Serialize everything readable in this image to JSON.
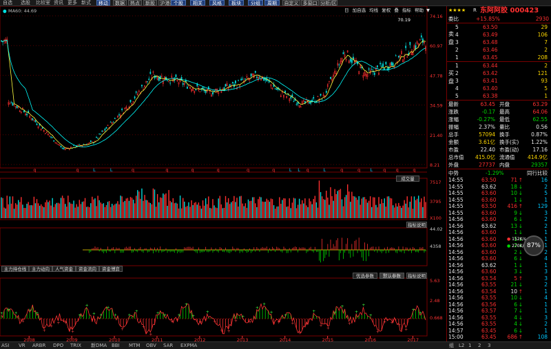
{
  "menu": [
    "自选",
    "选股",
    "比较室",
    "资讯",
    "更多",
    "新式"
  ],
  "toolbar": [
    "移动",
    "数据",
    "热点",
    "新股",
    "沪港通",
    "个股",
    "相关",
    "风格",
    "板块",
    "分组",
    "周期",
    "自定义",
    "多窗口",
    "分析/区"
  ],
  "chart_header": {
    "period_menu": [
      "日",
      "加自选",
      "均线",
      "复权",
      "叠",
      "指标",
      "帮助",
      "▼"
    ],
    "ma_label": "MA60: 44.69"
  },
  "stock": {
    "stars": "★★★★",
    "code_marker": "R",
    "name": "东阿阿胶 000423"
  },
  "order_book": {
    "weibi_label": "委比",
    "weibi_value": "+15.85%",
    "weicha_value": "2930",
    "sell_label": "卖盘",
    "buy_label": "买盘",
    "asks": [
      {
        "level": "5",
        "price": "63.50",
        "vol": "29"
      },
      {
        "level": "4",
        "price": "63.49",
        "vol": "106"
      },
      {
        "level": "3",
        "price": "63.48",
        "vol": "7"
      },
      {
        "level": "2",
        "price": "63.46",
        "vol": "2"
      },
      {
        "level": "1",
        "price": "63.45",
        "vol": "208"
      }
    ],
    "bids": [
      {
        "level": "1",
        "price": "63.44",
        "vol": "2"
      },
      {
        "level": "2",
        "price": "63.42",
        "vol": "121"
      },
      {
        "level": "3",
        "price": "63.41",
        "vol": "93"
      },
      {
        "level": "4",
        "price": "63.40",
        "vol": "5"
      },
      {
        "level": "5",
        "price": "63.38",
        "vol": "1"
      }
    ]
  },
  "quote": [
    {
      "l1": "最新",
      "v1": "63.45",
      "c1": "red",
      "l2": "开盘",
      "v2": "63.29",
      "c2": "red"
    },
    {
      "l1": "涨跌",
      "v1": "-0.17",
      "c1": "grn",
      "l2": "最高",
      "v2": "64.06",
      "c2": "red"
    },
    {
      "l1": "涨幅",
      "v1": "-0.27%",
      "c1": "grn",
      "l2": "最低",
      "v2": "62.55",
      "c2": "grn"
    },
    {
      "l1": "振幅",
      "v1": "2.37%",
      "c1": "wht",
      "l2": "量比",
      "v2": "0.56",
      "c2": "wht"
    },
    {
      "l1": "总手",
      "v1": "57094",
      "c1": "yel",
      "l2": "换手",
      "v2": "0.87%",
      "c2": "wht"
    },
    {
      "l1": "金额",
      "v1": "3.61亿",
      "c1": "yel",
      "l2": "换手(实)",
      "v2": "1.22%",
      "c2": "wht"
    },
    {
      "l1": "市盈",
      "v1": "22.40",
      "c1": "wht",
      "l2": "市盈(动)",
      "v2": "17.16",
      "c2": "wht"
    },
    {
      "l1": "总市值",
      "v1": "415.0亿",
      "c1": "yel",
      "l2": "流通值",
      "v2": "414.9亿",
      "c2": "yel"
    },
    {
      "l1": "外盘",
      "v1": "27737",
      "c1": "red",
      "l2": "内盘",
      "v2": "29357",
      "c2": "grn"
    }
  ],
  "tape_header": {
    "left": "中势",
    "mid": "-1.29%",
    "right": "同行比较"
  },
  "trades": [
    {
      "t": "14:55",
      "p": "63.50",
      "v": "71",
      "d": "up",
      "n": "16",
      "pc": "red",
      "vc": "red"
    },
    {
      "t": "14:55",
      "p": "63.62",
      "v": "18",
      "d": "dn",
      "n": "2",
      "pc": "wht",
      "vc": "grn"
    },
    {
      "t": "14:55",
      "p": "63.60",
      "v": "10",
      "d": "dn",
      "n": "5",
      "pc": "red",
      "vc": "grn"
    },
    {
      "t": "14:55",
      "p": "63.60",
      "v": "1",
      "d": "dn",
      "n": "1",
      "pc": "red",
      "vc": "grn"
    },
    {
      "t": "14:55",
      "p": "63.50",
      "v": "416",
      "d": "up",
      "n": "129",
      "pc": "red",
      "vc": "red"
    },
    {
      "t": "14:55",
      "p": "63.60",
      "v": "9",
      "d": "dn",
      "n": "3",
      "pc": "red",
      "vc": "grn"
    },
    {
      "t": "14:56",
      "p": "63.60",
      "v": "6",
      "d": "dn",
      "n": "2",
      "pc": "red",
      "vc": "grn"
    },
    {
      "t": "14:56",
      "p": "63.62",
      "v": "13",
      "d": "dn",
      "n": "2",
      "pc": "wht",
      "vc": "grn"
    },
    {
      "t": "14:56",
      "p": "63.60",
      "v": "1",
      "d": "dn",
      "n": "1",
      "pc": "red",
      "vc": "grn"
    },
    {
      "t": "14:56",
      "p": "63.60",
      "v": "1",
      "d": "dn",
      "n": "1",
      "pc": "red",
      "vc": "grn"
    },
    {
      "t": "14:56",
      "p": "63.60",
      "v": "2",
      "d": "dn",
      "n": "1",
      "pc": "red",
      "vc": "grn"
    },
    {
      "t": "14:56",
      "p": "63.60",
      "v": "2",
      "d": "dn",
      "n": "2",
      "pc": "red",
      "vc": "grn"
    },
    {
      "t": "14:56",
      "p": "63.60",
      "v": "6",
      "d": "dn",
      "n": "4",
      "pc": "red",
      "vc": "grn"
    },
    {
      "t": "14:56",
      "p": "63.62",
      "v": "1",
      "d": "dn",
      "n": "1",
      "pc": "wht",
      "vc": "grn"
    },
    {
      "t": "14:56",
      "p": "63.60",
      "v": "3",
      "d": "dn",
      "n": "3",
      "pc": "red",
      "vc": "grn"
    },
    {
      "t": "14:56",
      "p": "63.54",
      "v": "5",
      "d": "up",
      "n": "3",
      "pc": "red",
      "vc": "red"
    },
    {
      "t": "14:56",
      "p": "63.55",
      "v": "21",
      "d": "dn",
      "n": "2",
      "pc": "red",
      "vc": "grn"
    },
    {
      "t": "14:56",
      "p": "63.54",
      "v": "10",
      "d": "up",
      "n": "1",
      "pc": "red",
      "vc": "wht"
    },
    {
      "t": "14:56",
      "p": "63.55",
      "v": "10",
      "d": "dn",
      "n": "4",
      "pc": "red",
      "vc": "grn"
    },
    {
      "t": "14:56",
      "p": "63.56",
      "v": "6",
      "d": "dn",
      "n": "1",
      "pc": "red",
      "vc": "grn"
    },
    {
      "t": "14:56",
      "p": "63.57",
      "v": "7",
      "d": "dn",
      "n": "1",
      "pc": "red",
      "vc": "grn"
    },
    {
      "t": "14:56",
      "p": "63.55",
      "v": "4",
      "d": "dn",
      "n": "3",
      "pc": "red",
      "vc": "grn"
    },
    {
      "t": "14:56",
      "p": "63.55",
      "v": "4",
      "d": "dn",
      "n": "2",
      "pc": "red",
      "vc": "grn"
    },
    {
      "t": "14:57",
      "p": "63.45",
      "v": "6",
      "d": "dn",
      "n": "1",
      "pc": "red",
      "vc": "grn"
    },
    {
      "t": "15:00",
      "p": "63.45",
      "v": "686",
      "d": "up",
      "n": "108",
      "pc": "red",
      "vc": "red"
    }
  ],
  "speed_gauge": {
    "up": "152K/s",
    "down": "270K/s",
    "pct": "87%"
  },
  "panel_tabs": [
    "主力持仓线",
    "主力动向",
    "人气资金",
    "资金流向",
    "资金博弈"
  ],
  "lower_panel_buttons": [
    "优选参数",
    "默认参数",
    "指标说明"
  ],
  "volume_button": "成交量",
  "indicator_button": "指标说明",
  "bottom_tabs": [
    "ASI",
    "VR",
    "ARBR",
    "DPO",
    "TRIX",
    "新DMA",
    "BBI",
    "MTM",
    "OBV",
    "SAR",
    "EXPMA"
  ],
  "bottom_right_tabs": [
    "组",
    "L2",
    "1",
    "2",
    "3"
  ],
  "chart_data": [
    {
      "type": "candlestick",
      "title": "东阿阿胶 000423",
      "y_ticks": [
        "74.16",
        "60.97",
        "47.78",
        "34.59",
        "21.40",
        "8.21"
      ],
      "ylim": [
        8.21,
        74.16
      ],
      "marker_high": "70.19",
      "x_ticks": [
        "2008",
        "2009",
        "2010",
        "2011",
        "2012",
        "2013",
        "2014",
        "2015",
        "2016",
        "2017"
      ],
      "series": [
        {
          "name": "MA60",
          "value_shown": "44.69"
        }
      ],
      "approx_close_by_year": {
        "2007.5": 37,
        "2008.0": 30,
        "2008.8": 15,
        "2009.5": 18,
        "2010.3": 34,
        "2010.9": 48,
        "2011.5": 45,
        "2012.2": 40,
        "2012.9": 44,
        "2013.4": 48,
        "2013.9": 40,
        "2014.4": 35,
        "2014.9": 38,
        "2015.4": 58,
        "2015.9": 48,
        "2016.5": 53,
        "2017.0": 60,
        "2017.2": 63
      }
    },
    {
      "type": "bar",
      "title": "成交量",
      "y_ticks": [
        "7517",
        "3795",
        "X100"
      ]
    },
    {
      "type": "bar",
      "title": "主力持仓线",
      "y_ticks": [
        "44.02",
        "4358"
      ]
    },
    {
      "type": "line",
      "title": "主力动向",
      "y_ticks": [
        "5.63",
        "2.48",
        "0.668"
      ]
    }
  ],
  "colors": {
    "up": "#ff3030",
    "down": "#00d8d8",
    "ma": "#ffff40",
    "ma60": "#00ffff",
    "grid": "#7a0000"
  }
}
